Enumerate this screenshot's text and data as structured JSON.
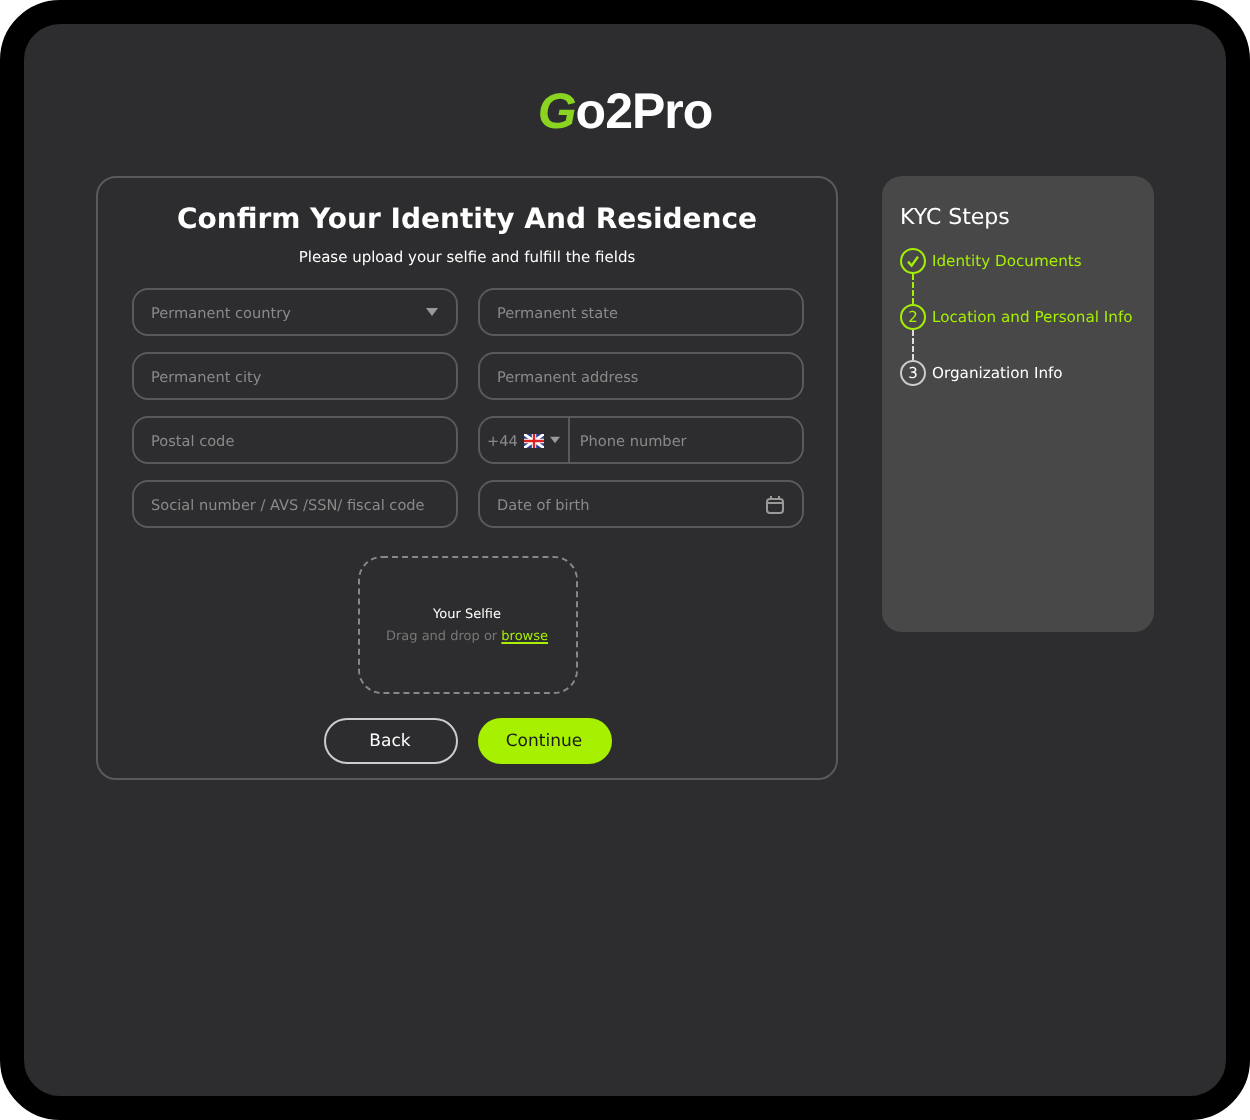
{
  "logo": {
    "mark": "G",
    "text": "o2Pro"
  },
  "form": {
    "title": "Confirm Your Identity And Residence",
    "subtitle": "Please upload  your selfie and  fulfill the fields",
    "fields": [
      {
        "kind": "select",
        "placeholder": "Permanent country"
      },
      {
        "kind": "text",
        "placeholder": "Permanent state"
      },
      {
        "kind": "text",
        "placeholder": "Permanent city"
      },
      {
        "kind": "text",
        "placeholder": "Permanent address"
      },
      {
        "kind": "text",
        "placeholder": "Postal code"
      },
      {
        "kind": "phone",
        "code": "+44",
        "placeholder": "Phone number"
      },
      {
        "kind": "text",
        "placeholder": "Social number / AVS /SSN/ fiscal code"
      },
      {
        "kind": "date",
        "placeholder": "Date of birth"
      }
    ],
    "upload": {
      "title": "Your Selfie",
      "hint": "Drag and drop or",
      "link": "browse"
    },
    "buttons": [
      {
        "kind": "secondary",
        "label": "Back"
      },
      {
        "kind": "primary",
        "label": "Continue"
      }
    ]
  },
  "steps": {
    "title": "KYC Steps",
    "items": [
      {
        "completed": true,
        "current": false,
        "label": "Identity Documents"
      },
      {
        "completed": false,
        "current": true,
        "number": "2",
        "label": "Location and Personal Info"
      },
      {
        "completed": false,
        "current": false,
        "number": "3",
        "label": "Organization Info"
      }
    ]
  }
}
